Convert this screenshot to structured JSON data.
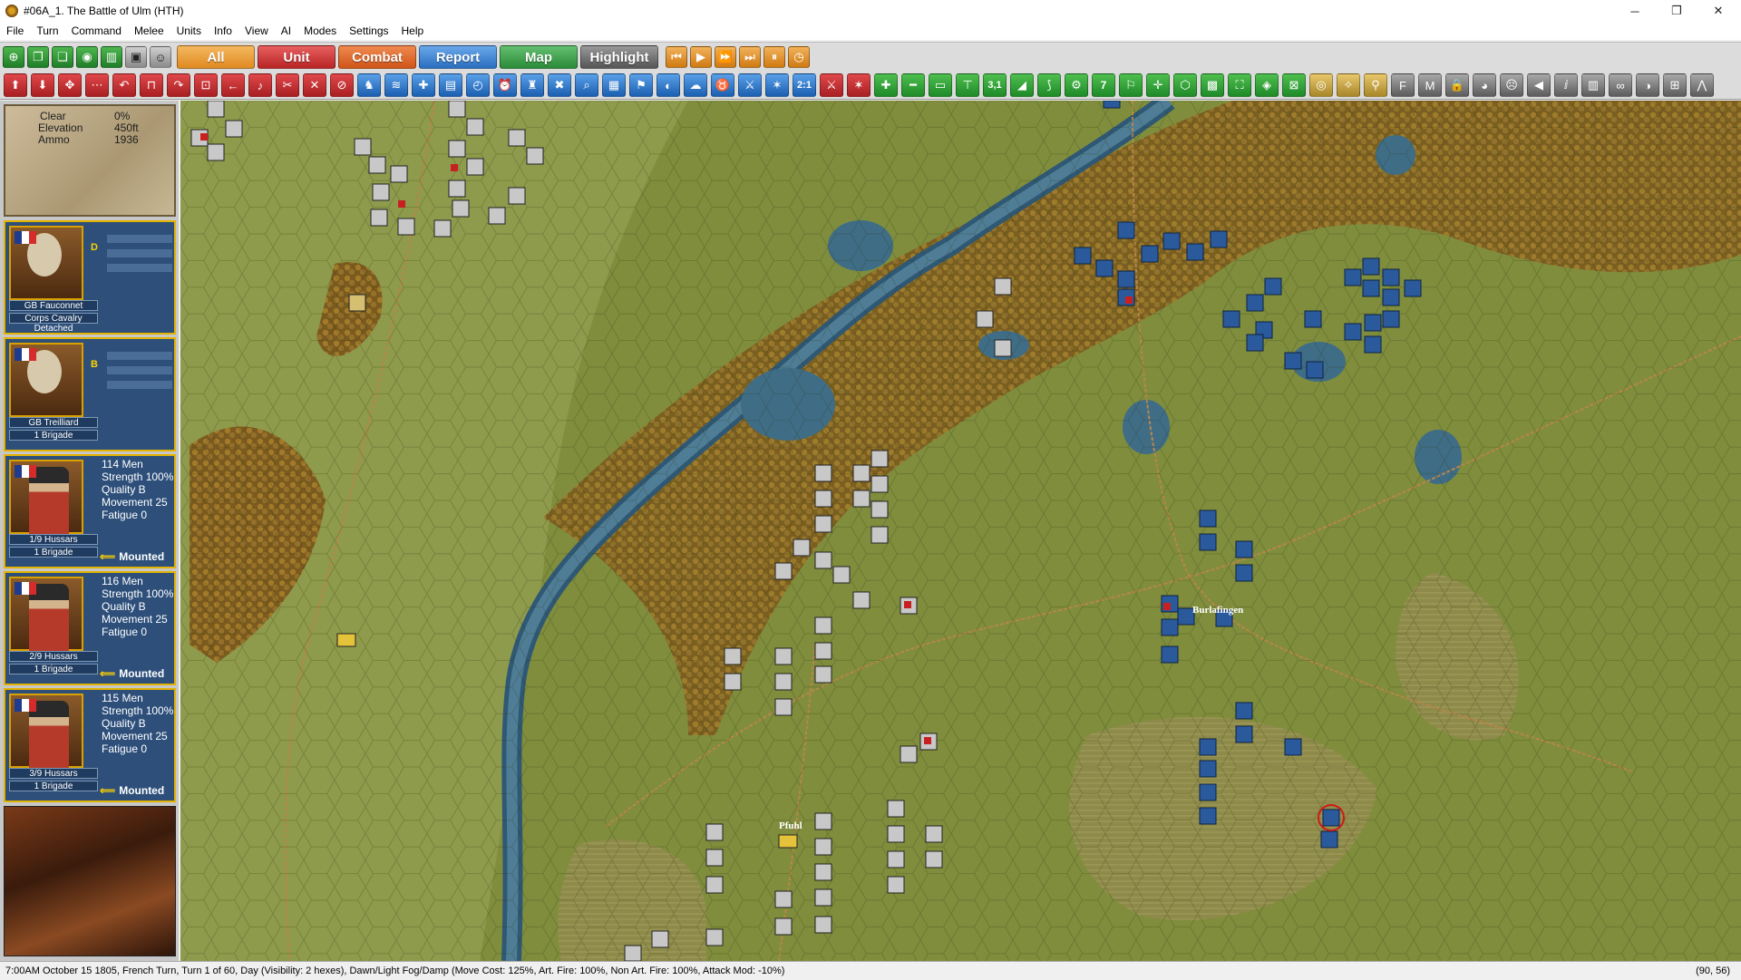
{
  "window": {
    "title": "#06A_1. The Battle of Ulm (HTH)",
    "minimize_glyph": "─",
    "maximize_glyph": "❐",
    "close_glyph": "✕"
  },
  "menu": [
    "File",
    "Turn",
    "Command",
    "Melee",
    "Units",
    "Info",
    "View",
    "AI",
    "Modes",
    "Settings",
    "Help"
  ],
  "toolbar": {
    "tabs": [
      {
        "label": "All",
        "color": "#f0a030"
      },
      {
        "label": "Unit",
        "color": "#d63a3a"
      },
      {
        "label": "Combat",
        "color": "#e8642a"
      },
      {
        "label": "Report",
        "color": "#3d85d6"
      },
      {
        "label": "Map",
        "color": "#3da64a"
      },
      {
        "label": "Highlight",
        "color": "#6e6e6e"
      }
    ],
    "row2_text": {
      "ratio": "2:1",
      "scale": "3,1",
      "num": "7"
    }
  },
  "terrain_info": {
    "rows": [
      {
        "label": "Clear",
        "value": "0%"
      },
      {
        "label": "Elevation",
        "value": "450ft"
      },
      {
        "label": "Ammo",
        "value": "1936"
      }
    ]
  },
  "leaders": [
    {
      "name": "GB Fauconnet",
      "formation": "Corps Cavalry",
      "status": "Detached",
      "rating": "D"
    },
    {
      "name": "GB Treilliard",
      "formation": "1 Brigade",
      "rating": "B"
    }
  ],
  "units": [
    {
      "men": "114 Men",
      "strength": "Strength 100%",
      "quality": "Quality B",
      "movement": "Movement 25",
      "fatigue": "Fatigue 0",
      "name": "1/9 Hussars",
      "brigade": "1 Brigade",
      "formation": "Mounted"
    },
    {
      "men": "116 Men",
      "strength": "Strength 100%",
      "quality": "Quality B",
      "movement": "Movement 25",
      "fatigue": "Fatigue 0",
      "name": "2/9 Hussars",
      "brigade": "1 Brigade",
      "formation": "Mounted"
    },
    {
      "men": "115 Men",
      "strength": "Strength 100%",
      "quality": "Quality B",
      "movement": "Movement 25",
      "fatigue": "Fatigue 0",
      "name": "3/9 Hussars",
      "brigade": "1 Brigade",
      "formation": "Mounted"
    }
  ],
  "map": {
    "towns": [
      "Burlafingen",
      "Pfuhl"
    ],
    "colors": {
      "grass": "#7d8b3c",
      "forest": "#8a6a24",
      "water": "#3f6d86",
      "french": "#2a5a9c",
      "austrian": "#c8c8c8"
    }
  },
  "status_bar": {
    "text": "7:00AM October 15 1805, French Turn, Turn 1 of 60, Day (Visibility: 2 hexes), Dawn/Light Fog/Damp (Move Cost: 125%, Art. Fire: 100%, Non Art. Fire: 100%, Attack Mod: -10%)",
    "coords": "(90, 56)"
  }
}
